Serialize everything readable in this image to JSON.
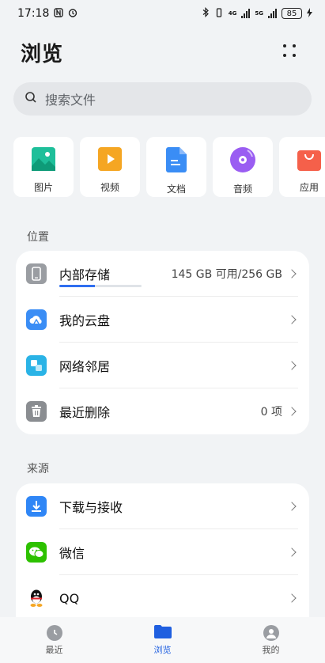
{
  "status_bar": {
    "time": "17:18",
    "network": "4G",
    "network2": "5G",
    "battery": "85"
  },
  "header": {
    "title": "浏览"
  },
  "search": {
    "placeholder": "搜索文件"
  },
  "categories": [
    {
      "label": "图片",
      "icon": "image-icon",
      "color": "#1ebf9a"
    },
    {
      "label": "视频",
      "icon": "video-icon",
      "color": "#f5a623"
    },
    {
      "label": "文档",
      "icon": "document-icon",
      "color": "#3a8df5"
    },
    {
      "label": "音频",
      "icon": "audio-icon",
      "color": "#9a5df2"
    },
    {
      "label": "应用",
      "icon": "app-icon",
      "color": "#f5604a"
    }
  ],
  "locations": {
    "label": "位置",
    "items": [
      {
        "label": "内部存储",
        "meta": "145 GB 可用/256 GB",
        "icon": "phone-icon",
        "usage_fraction": 0.43
      },
      {
        "label": "我的云盘",
        "meta": "",
        "icon": "cloud-drive-icon"
      },
      {
        "label": "网络邻居",
        "meta": "",
        "icon": "network-icon"
      },
      {
        "label": "最近删除",
        "meta": "0 项",
        "icon": "trash-icon"
      }
    ]
  },
  "sources": {
    "label": "来源",
    "items": [
      {
        "label": "下载与接收",
        "icon": "download-icon"
      },
      {
        "label": "微信",
        "icon": "wechat-icon"
      },
      {
        "label": "QQ",
        "icon": "qq-icon"
      }
    ]
  },
  "bottom_nav": [
    {
      "label": "最近",
      "icon": "clock-icon",
      "active": false
    },
    {
      "label": "浏览",
      "icon": "folder-icon",
      "active": true
    },
    {
      "label": "我的",
      "icon": "user-icon",
      "active": false
    }
  ],
  "colors": {
    "accent": "#1f5fe0",
    "background": "#f1f3f5"
  }
}
